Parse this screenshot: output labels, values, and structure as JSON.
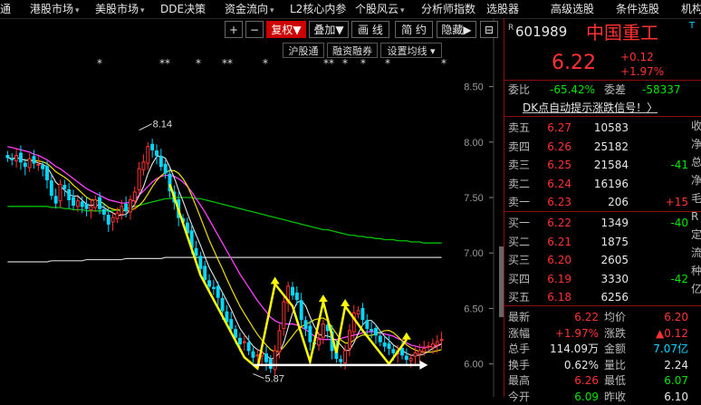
{
  "menubar": {
    "items": [
      {
        "label": "通",
        "caret": false
      },
      {
        "label": "港股市场",
        "caret": true
      },
      {
        "label": "美股市场",
        "caret": true
      },
      {
        "label": "DDE决策",
        "caret": false
      },
      {
        "label": "资金流向",
        "caret": true
      },
      {
        "label": "L2核心内参",
        "caret": false
      },
      {
        "label": "个股风云",
        "caret": true
      },
      {
        "label": "分析师指数",
        "caret": false
      },
      {
        "label": "选股器",
        "caret": false
      },
      {
        "label": "高级选股",
        "caret": false
      },
      {
        "label": "条件选股",
        "caret": false
      },
      {
        "label": "机构",
        "caret": false
      }
    ]
  },
  "toolbar": {
    "plus": "+",
    "minus": "−",
    "fuquan": "复权▼",
    "diejia": "叠加▼",
    "huaxian": "画 线",
    "jianyue": "简 约",
    "yincang": "隐藏▶",
    "corner": "⊟",
    "hugutong": "沪股通",
    "rongzi": "融资融券",
    "settings": "设置均线 ▾"
  },
  "chart_data": {
    "type": "candlestick",
    "yticks": [
      8.5,
      8.0,
      7.5,
      7.0,
      6.5,
      6.0
    ],
    "ylim": [
      5.85,
      8.75
    ],
    "annotations": [
      {
        "label": "8.14",
        "value": 8.14
      },
      {
        "label": "5.87",
        "value": 5.87
      }
    ],
    "markers_row1": [
      "*",
      "**",
      "*",
      "**",
      "*",
      "*"
    ],
    "markers_row2": [
      "**",
      "*",
      "*",
      "*",
      "*",
      "*"
    ],
    "colors": {
      "up": "#ff3232",
      "down": "#00d8ff",
      "ma5": "#e6e6e6",
      "ma10": "#f0e000",
      "ma20": "#ff40ff",
      "ma60": "#00c000",
      "ma120": "#cccccc",
      "signal": "#ffff00"
    },
    "x": [
      0,
      1,
      2,
      3,
      4,
      5,
      6,
      7,
      8,
      9,
      10,
      11,
      12,
      13,
      14,
      15,
      16,
      17,
      18,
      19,
      20,
      21,
      22,
      23,
      24,
      25,
      26,
      27,
      28,
      29,
      30,
      31,
      32,
      33,
      34,
      35,
      36,
      37,
      38,
      39,
      40,
      41,
      42,
      43,
      44,
      45,
      46,
      47,
      48,
      49,
      50,
      51,
      52,
      53,
      54,
      55,
      56,
      57,
      58,
      59,
      60,
      61,
      62,
      63,
      64,
      65,
      66,
      67,
      68,
      69,
      70,
      71,
      72,
      73,
      74,
      75,
      76,
      77,
      78,
      79,
      80,
      81,
      82,
      83,
      84,
      85,
      86,
      87,
      88,
      89,
      90,
      91,
      92,
      93,
      94,
      95,
      96,
      97,
      98,
      99
    ],
    "close": [
      7.86,
      7.84,
      7.88,
      7.82,
      7.78,
      7.85,
      7.81,
      7.8,
      7.76,
      7.66,
      7.52,
      7.45,
      7.62,
      7.58,
      7.48,
      7.43,
      7.47,
      7.42,
      7.4,
      7.42,
      7.48,
      7.4,
      7.35,
      7.26,
      7.32,
      7.36,
      7.42,
      7.38,
      7.48,
      7.55,
      7.76,
      7.82,
      7.96,
      7.93,
      7.88,
      7.78,
      7.72,
      7.56,
      7.46,
      7.32,
      7.28,
      7.18,
      7.05,
      6.98,
      6.86,
      6.76,
      6.7,
      6.68,
      6.6,
      6.48,
      6.38,
      6.32,
      6.24,
      6.18,
      6.2,
      6.12,
      6.06,
      6.08,
      6.1,
      6.02,
      5.96,
      6.12,
      6.3,
      6.56,
      6.7,
      6.62,
      6.58,
      6.4,
      6.32,
      6.2,
      6.18,
      6.22,
      6.36,
      6.3,
      6.12,
      6.05,
      6.02,
      6.12,
      6.3,
      6.46,
      6.48,
      6.4,
      6.32,
      6.3,
      6.26,
      6.2,
      6.16,
      6.14,
      6.1,
      6.12,
      6.08,
      6.04,
      6.05,
      6.1,
      6.12,
      6.14,
      6.16,
      6.18,
      6.2,
      6.22
    ],
    "ma20": [
      7.96,
      7.95,
      7.94,
      7.93,
      7.92,
      7.91,
      7.89,
      7.88,
      7.86,
      7.84,
      7.81,
      7.78,
      7.76,
      7.73,
      7.7,
      7.67,
      7.64,
      7.61,
      7.58,
      7.56,
      7.54,
      7.52,
      7.5,
      7.48,
      7.47,
      7.46,
      7.45,
      7.45,
      7.46,
      7.48,
      7.52,
      7.56,
      7.6,
      7.64,
      7.67,
      7.69,
      7.7,
      7.7,
      7.69,
      7.67,
      7.64,
      7.6,
      7.55,
      7.49,
      7.43,
      7.37,
      7.3,
      7.23,
      7.16,
      7.09,
      7.02,
      6.95,
      6.88,
      6.81,
      6.75,
      6.69,
      6.63,
      6.57,
      6.52,
      6.47,
      6.42,
      6.39,
      6.37,
      6.36,
      6.36,
      6.36,
      6.35,
      6.33,
      6.31,
      6.28,
      6.25,
      6.23,
      6.22,
      6.22,
      6.22,
      6.22,
      6.23,
      6.24,
      6.25,
      6.26,
      6.27,
      6.28,
      6.29,
      6.29,
      6.29,
      6.28,
      6.27,
      6.26,
      6.25,
      6.23,
      6.21,
      6.19,
      6.17,
      6.16,
      6.15,
      6.15,
      6.15,
      6.16,
      6.17,
      6.18
    ],
    "ma60": [
      7.42,
      7.42,
      7.42,
      7.42,
      7.42,
      7.42,
      7.42,
      7.42,
      7.42,
      7.42,
      7.41,
      7.41,
      7.41,
      7.4,
      7.4,
      7.39,
      7.39,
      7.39,
      7.38,
      7.38,
      7.38,
      7.38,
      7.38,
      7.38,
      7.38,
      7.39,
      7.39,
      7.4,
      7.41,
      7.42,
      7.43,
      7.44,
      7.45,
      7.46,
      7.47,
      7.48,
      7.49,
      7.49,
      7.5,
      7.5,
      7.5,
      7.5,
      7.5,
      7.49,
      7.49,
      7.48,
      7.47,
      7.46,
      7.45,
      7.44,
      7.43,
      7.42,
      7.41,
      7.4,
      7.39,
      7.38,
      7.37,
      7.36,
      7.35,
      7.34,
      7.33,
      7.32,
      7.31,
      7.3,
      7.29,
      7.28,
      7.27,
      7.26,
      7.25,
      7.24,
      7.23,
      7.22,
      7.21,
      7.21,
      7.2,
      7.19,
      7.18,
      7.17,
      7.16,
      7.16,
      7.15,
      7.15,
      7.14,
      7.14,
      7.13,
      7.13,
      7.12,
      7.12,
      7.12,
      7.11,
      7.11,
      7.11,
      7.1,
      7.1,
      7.1,
      7.09,
      7.09,
      7.09,
      7.09,
      7.09
    ],
    "ma120": [
      6.92,
      6.92,
      6.92,
      6.92,
      6.92,
      6.92,
      6.92,
      6.92,
      6.92,
      6.92,
      6.93,
      6.93,
      6.93,
      6.93,
      6.93,
      6.93,
      6.93,
      6.93,
      6.94,
      6.94,
      6.94,
      6.94,
      6.94,
      6.94,
      6.94,
      6.94,
      6.94,
      6.95,
      6.95,
      6.95,
      6.95,
      6.95,
      6.95,
      6.95,
      6.95,
      6.95,
      6.96,
      6.96,
      6.96,
      6.96,
      6.96,
      6.96,
      6.96,
      6.96,
      6.96,
      6.96,
      6.96,
      6.96,
      6.96,
      6.96,
      6.96,
      6.96,
      6.96,
      6.96,
      6.96,
      6.96,
      6.96,
      6.96,
      6.96,
      6.96,
      6.96,
      6.96,
      6.96,
      6.96,
      6.96,
      6.96,
      6.96,
      6.96,
      6.96,
      6.96,
      6.96,
      6.96,
      6.96,
      6.96,
      6.96,
      6.96,
      6.96,
      6.96,
      6.96,
      6.96,
      6.96,
      6.96,
      6.96,
      6.96,
      6.96,
      6.96,
      6.96,
      6.96,
      6.96,
      6.96,
      6.96,
      6.96,
      6.96,
      6.96,
      6.96,
      6.96,
      6.96,
      6.96,
      6.96,
      6.96
    ],
    "signal_path": [
      [
        0,
        0
      ],
      [
        0,
        0
      ]
    ],
    "support_line": {
      "value": 5.99
    }
  },
  "quote": {
    "r_mark": "R",
    "code": "601989",
    "name": "中国重工",
    "t_mark": "T",
    "price": "6.22",
    "change": "+0.12",
    "change_pct": "+1.97%",
    "weibi_label": "委比",
    "weibi_value": "-65.42%",
    "weicha_label": "委差",
    "weicha_value": "-58337",
    "dk_signal": "DK点自动提示涨跌信号！〉",
    "sells": [
      {
        "label": "卖五",
        "price": "6.27",
        "vol": "10583",
        "delta": ""
      },
      {
        "label": "卖四",
        "price": "6.26",
        "vol": "25182",
        "delta": ""
      },
      {
        "label": "卖三",
        "price": "6.25",
        "vol": "21584",
        "delta": "-41"
      },
      {
        "label": "卖二",
        "price": "6.24",
        "vol": "16196",
        "delta": ""
      },
      {
        "label": "卖一",
        "price": "6.23",
        "vol": "206",
        "delta": "+15"
      }
    ],
    "buys": [
      {
        "label": "买一",
        "price": "6.22",
        "vol": "1349",
        "delta": "-40"
      },
      {
        "label": "买二",
        "price": "6.21",
        "vol": "1875",
        "delta": ""
      },
      {
        "label": "买三",
        "price": "6.20",
        "vol": "2605",
        "delta": ""
      },
      {
        "label": "买四",
        "price": "6.19",
        "vol": "3330",
        "delta": "-42"
      },
      {
        "label": "买五",
        "price": "6.18",
        "vol": "6256",
        "delta": ""
      }
    ],
    "stats": [
      {
        "l1": "最新",
        "v1": "6.22",
        "c1": "red",
        "l2": "均价",
        "v2": "6.20",
        "c2": "red"
      },
      {
        "l1": "涨幅",
        "v1": "+1.97%",
        "c1": "red",
        "l2": "涨跌",
        "v2": "▲0.12",
        "c2": "red"
      },
      {
        "l1": "总手",
        "v1": "114.09万",
        "c1": "white",
        "l2": "金额",
        "v2": "7.07亿",
        "c2": "cyan"
      },
      {
        "l1": "换手",
        "v1": "0.62%",
        "c1": "white",
        "l2": "量比",
        "v2": "2.24",
        "c2": "white"
      },
      {
        "l1": "最高",
        "v1": "6.26",
        "c1": "red",
        "l2": "最低",
        "v2": "6.07",
        "c2": "green"
      },
      {
        "l1": "今开",
        "v1": "6.09",
        "c1": "green",
        "l2": "昨收",
        "v2": "6.10",
        "c2": "white"
      }
    ],
    "side_chars": [
      "收",
      "净",
      "总",
      "净",
      "毛",
      "R",
      "定",
      "流",
      "种",
      "亿"
    ]
  }
}
